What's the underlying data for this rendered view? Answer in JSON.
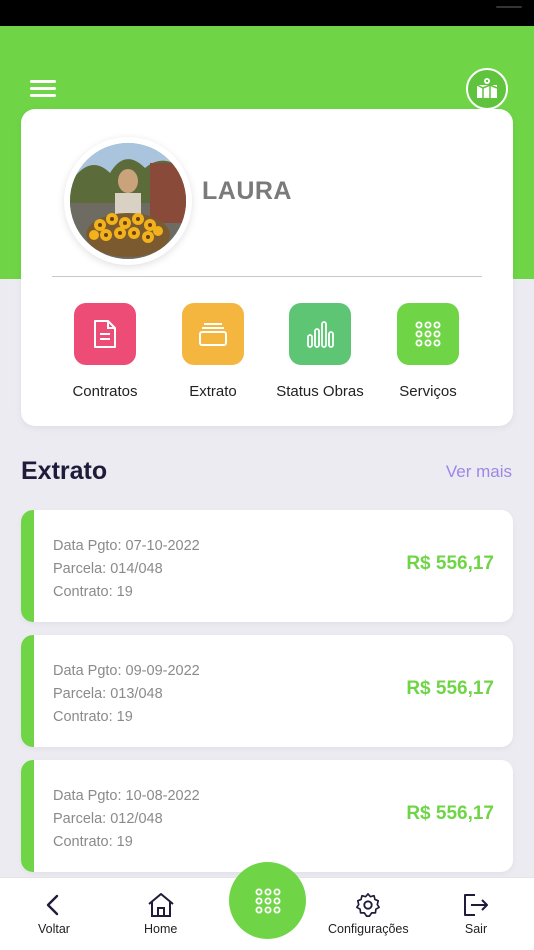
{
  "user": {
    "name": "LAURA"
  },
  "header": {
    "menu_icon": "hamburger-menu-icon",
    "logo_icon": "map-logo-icon"
  },
  "shortcuts": [
    {
      "label": "Contratos",
      "icon": "document-icon",
      "color": "#ec4c76"
    },
    {
      "label": "Extrato",
      "icon": "cards-icon",
      "color": "#f4b63e"
    },
    {
      "label": "Status Obras",
      "icon": "bar-chart-icon",
      "color": "#5ec575"
    },
    {
      "label": "Serviços",
      "icon": "grid-dots-icon",
      "color": "#6fd547"
    }
  ],
  "extrato": {
    "title": "Extrato",
    "see_more": "Ver mais",
    "entries": [
      {
        "date": "Data Pgto: 07-10-2022",
        "installment": "Parcela: 014/048",
        "contract": "Contrato: 19",
        "amount": "R$ 556,17"
      },
      {
        "date": "Data Pgto: 09-09-2022",
        "installment": "Parcela: 013/048",
        "contract": "Contrato: 19",
        "amount": "R$ 556,17"
      },
      {
        "date": "Data Pgto: 10-08-2022",
        "installment": "Parcela: 012/048",
        "contract": "Contrato: 19",
        "amount": "R$ 556,17"
      }
    ]
  },
  "bottom_nav": {
    "back": "Voltar",
    "home": "Home",
    "settings": "Configurações",
    "logout": "Sair"
  },
  "colors": {
    "primary_green": "#6fd547",
    "accent_purple": "#9d87e6",
    "background": "#ecebf2",
    "dark_text": "#1f1b3a"
  }
}
